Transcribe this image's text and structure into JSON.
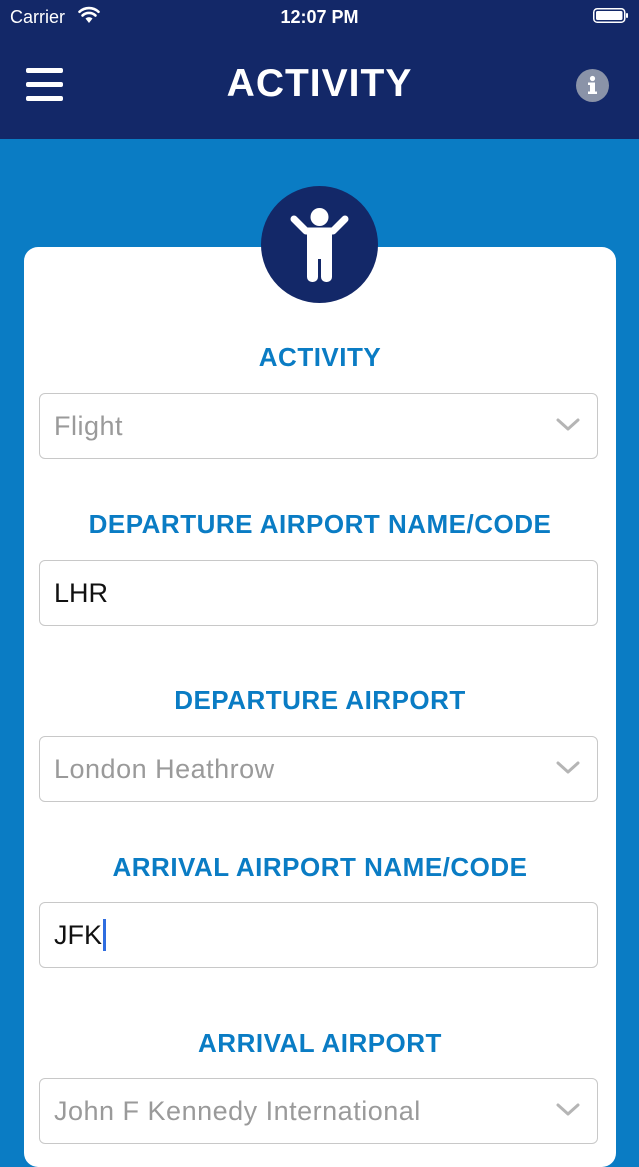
{
  "status_bar": {
    "carrier": "Carrier",
    "time": "12:07 PM"
  },
  "nav": {
    "title": "ACTIVITY",
    "menu_icon": "hamburger-menu-icon",
    "info_icon": "info-icon"
  },
  "colors": {
    "nav_background": "#132868",
    "page_background": "#0a7cc4",
    "label_color": "#0a7cc4",
    "placeholder_color": "#9a9a9a"
  },
  "form": {
    "activity_icon": "person-icon",
    "activity": {
      "label": "ACTIVITY",
      "value": "Flight"
    },
    "departure_code": {
      "label": "DEPARTURE AIRPORT NAME/CODE",
      "value": "LHR"
    },
    "departure_airport": {
      "label": "DEPARTURE AIRPORT",
      "value": "London Heathrow"
    },
    "arrival_code": {
      "label": "ARRIVAL AIRPORT NAME/CODE",
      "value": "JFK"
    },
    "arrival_airport": {
      "label": "ARRIVAL AIRPORT",
      "value": "John F Kennedy International"
    }
  }
}
